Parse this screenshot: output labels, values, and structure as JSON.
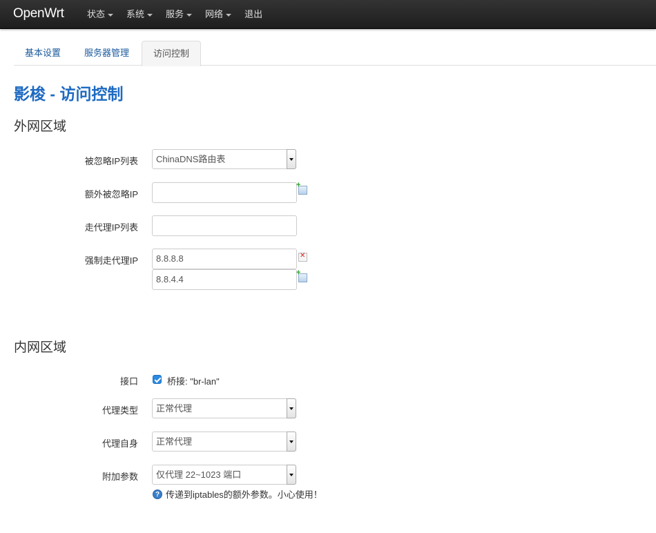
{
  "brand": "OpenWrt",
  "menu": [
    {
      "label": "状态",
      "dropdown": true
    },
    {
      "label": "系统",
      "dropdown": true
    },
    {
      "label": "服务",
      "dropdown": true
    },
    {
      "label": "网络",
      "dropdown": true
    },
    {
      "label": "退出",
      "dropdown": false
    }
  ],
  "tabs": [
    {
      "label": "基本设置",
      "active": false
    },
    {
      "label": "服务器管理",
      "active": false
    },
    {
      "label": "访问控制",
      "active": true
    }
  ],
  "page_title": "影梭 - 访问控制",
  "wan": {
    "title": "外网区域",
    "ignore_list": {
      "label": "被忽略IP列表",
      "value": "ChinaDNS路由表"
    },
    "extra_ignore": {
      "label": "额外被忽略IP",
      "value": ""
    },
    "proxy_list": {
      "label": "走代理IP列表",
      "value": ""
    },
    "force_proxy": {
      "label": "强制走代理IP",
      "values": [
        "8.8.8.8",
        "8.8.4.4"
      ]
    }
  },
  "lan": {
    "title": "内网区域",
    "interface": {
      "label": "接口",
      "option": "桥接: \"br-lan\"",
      "checked": true
    },
    "proxy_type": {
      "label": "代理类型",
      "value": "正常代理"
    },
    "self_proxy": {
      "label": "代理自身",
      "value": "正常代理"
    },
    "extra_args": {
      "label": "附加参数",
      "value": "仅代理 22~1023 端口",
      "help": "传递到iptables的额外参数。小心使用！"
    }
  },
  "colors": {
    "accent": "#1e6ac2",
    "navbar": "#222222",
    "link": "#1a5a9c",
    "checkbox": "#2a8ae0"
  },
  "icons": {
    "add": "add-icon",
    "remove": "remove-icon",
    "help": "help-icon",
    "caret": "caret-down-icon"
  }
}
